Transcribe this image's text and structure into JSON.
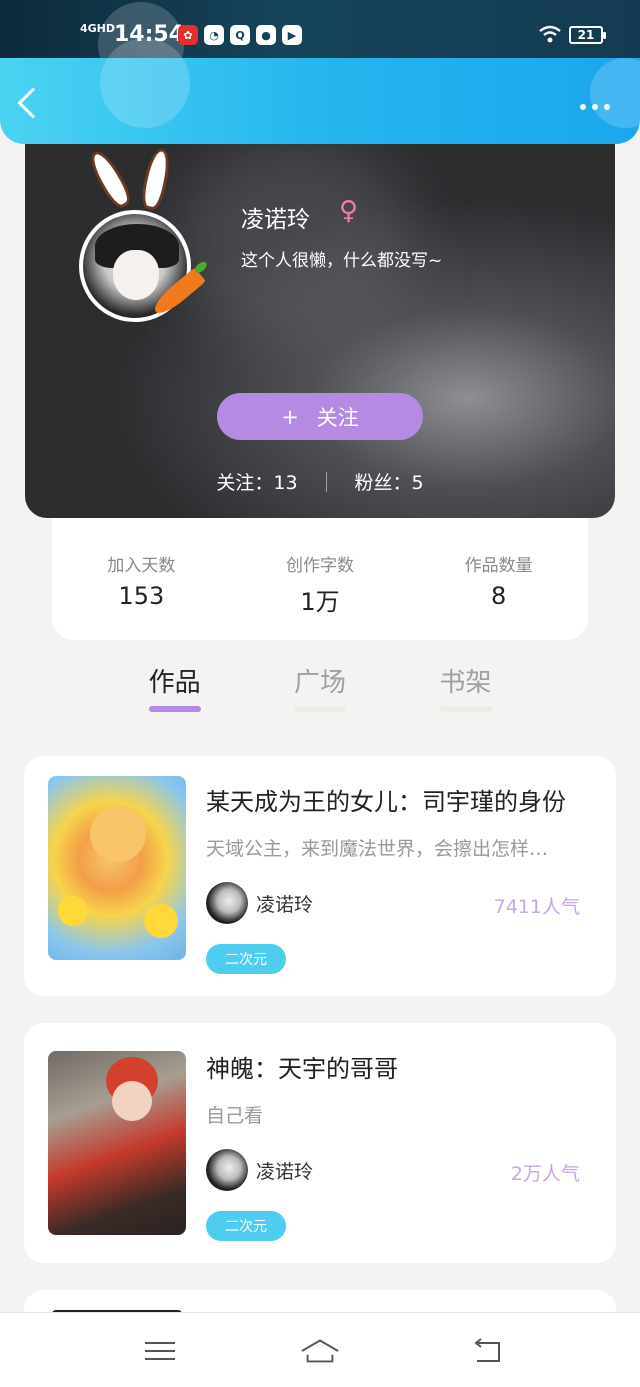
{
  "status_bar": {
    "network": "4GHD",
    "time": "14:54",
    "battery": "21",
    "icons": [
      "weibo-icon",
      "speed-icon",
      "q-icon",
      "chat-icon",
      "play-icon"
    ]
  },
  "header": {
    "back_icon": "chevron-left-icon",
    "more_icon": "more-dots-icon"
  },
  "profile": {
    "name": "凌诺玲",
    "gender_symbol": "♀",
    "bio": "这个人很懒，什么都没写~",
    "follow_button": "关注",
    "follow_plus": "+",
    "following": "关注：13",
    "fans": "粉丝：5"
  },
  "stats": [
    {
      "label": "加入天数",
      "value": "153"
    },
    {
      "label": "创作字数",
      "value": "1万"
    },
    {
      "label": "作品数量",
      "value": "8"
    }
  ],
  "tabs": [
    {
      "label": "作品",
      "active": true
    },
    {
      "label": "广场",
      "active": false
    },
    {
      "label": "书架",
      "active": false
    }
  ],
  "works": [
    {
      "title": "某天成为王的女儿：司宇瑾的身份",
      "desc": "天域公主，来到魔法世界，会擦出怎样…",
      "author": "凌诺玲",
      "popularity": "7411人气",
      "tag": "二次元"
    },
    {
      "title": "神魄：天宇的哥哥",
      "desc": "自己看",
      "author": "凌诺玲",
      "popularity": "2万人气",
      "tag": "二次元"
    }
  ],
  "colors": {
    "accent": "#b48ae2",
    "header_start": "#4ad3f2",
    "header_end": "#1ba6ee",
    "tag": "#4fcdf0",
    "gender": "#f27ea6"
  }
}
